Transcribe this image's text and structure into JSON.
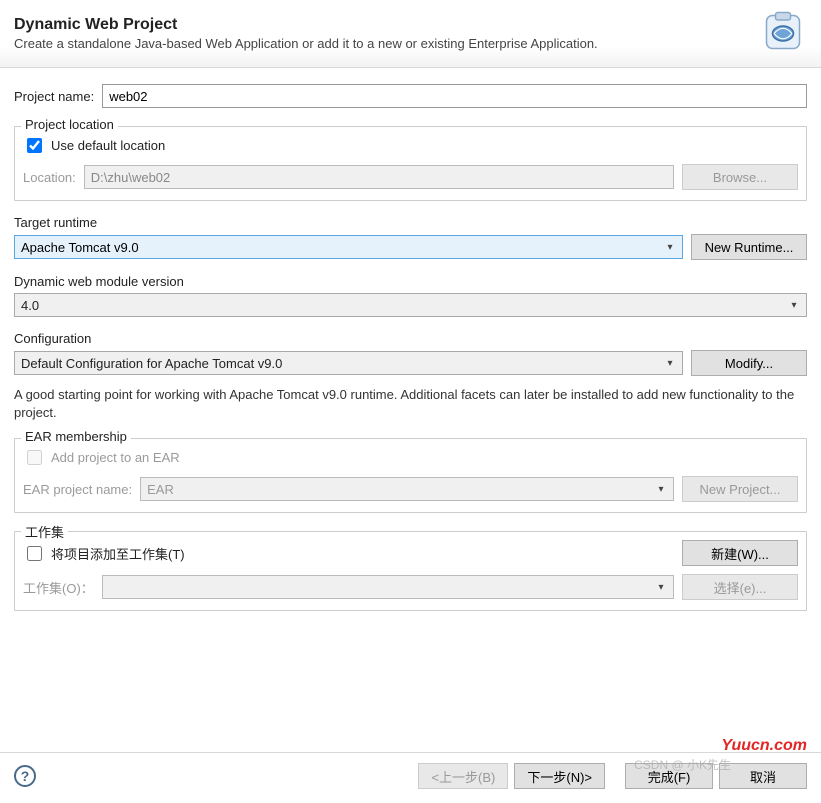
{
  "header": {
    "title": "Dynamic Web Project",
    "subtitle": "Create a standalone Java-based Web Application or add it to a new or existing Enterprise Application."
  },
  "project_name": {
    "label": "Project name:",
    "value": "web02"
  },
  "project_location": {
    "group_title": "Project location",
    "use_default_label": "Use default location",
    "use_default_checked": true,
    "location_label": "Location:",
    "location_value": "D:\\zhu\\web02",
    "browse_btn": "Browse..."
  },
  "target_runtime": {
    "label": "Target runtime",
    "value": "Apache Tomcat v9.0",
    "new_runtime_btn": "New Runtime..."
  },
  "module_version": {
    "label": "Dynamic web module version",
    "value": "4.0"
  },
  "configuration": {
    "label": "Configuration",
    "value": "Default Configuration for Apache Tomcat v9.0",
    "modify_btn": "Modify...",
    "description": "A good starting point for working with Apache Tomcat v9.0 runtime. Additional facets can later be installed to add new functionality to the project."
  },
  "ear": {
    "group_title": "EAR membership",
    "add_label": "Add project to an EAR",
    "add_checked": false,
    "name_label": "EAR project name:",
    "name_value": "EAR",
    "new_project_btn": "New Project..."
  },
  "working_sets": {
    "group_title": "工作集",
    "add_label": "将项目添加至工作集(T)",
    "add_checked": false,
    "sets_label": "工作集(O)：",
    "sets_value": "",
    "new_btn": "新建(W)...",
    "select_btn": "选择(e)..."
  },
  "footer": {
    "back": "<上一步(B)",
    "next": "下一步(N)>",
    "finish": "完成(F)",
    "cancel": "取消"
  },
  "watermarks": {
    "w1": "Yuucn.com",
    "w2": "CSDN @ 小K先生"
  }
}
